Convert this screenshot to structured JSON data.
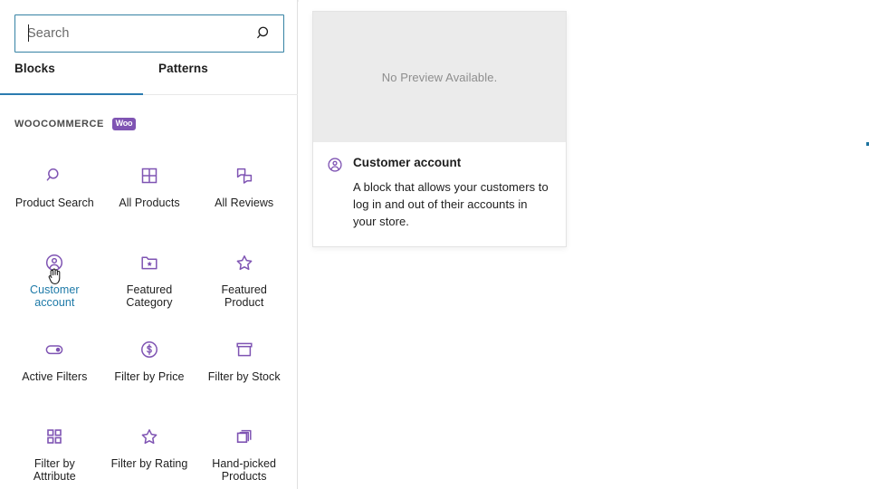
{
  "search": {
    "placeholder": "Search",
    "value": "",
    "icon": "search-icon"
  },
  "tabs": [
    {
      "label": "Blocks",
      "active": true
    },
    {
      "label": "Patterns",
      "active": false
    }
  ],
  "panel": {
    "title": "WOOCOMMERCE",
    "badge": "Woo",
    "badge_color": "#7f54b3"
  },
  "blocks": [
    {
      "label": "Product Search",
      "icon": "search-icon",
      "selected": false
    },
    {
      "label": "All Products",
      "icon": "grid-icon",
      "selected": false
    },
    {
      "label": "All Reviews",
      "icon": "comments-icon",
      "selected": false
    },
    {
      "label": "Customer account",
      "icon": "account-avatar-icon",
      "selected": true
    },
    {
      "label": "Featured Category",
      "icon": "folder-star-icon",
      "selected": false
    },
    {
      "label": "Featured Product",
      "icon": "star-icon",
      "selected": false
    },
    {
      "label": "Active Filters",
      "icon": "toggle-icon",
      "selected": false
    },
    {
      "label": "Filter by Price",
      "icon": "dollar-coin-icon",
      "selected": false
    },
    {
      "label": "Filter by Stock",
      "icon": "archive-box-icon",
      "selected": false
    },
    {
      "label": "Filter by Attribute",
      "icon": "four-squares-icon",
      "selected": false
    },
    {
      "label": "Filter by Rating",
      "icon": "star-icon",
      "selected": false
    },
    {
      "label": "Hand-picked Products",
      "icon": "stacked-squares-icon",
      "selected": false
    }
  ],
  "preview": {
    "media_text": "No Preview Available.",
    "title": "Customer account",
    "icon": "account-avatar-icon",
    "description": "A block that allows your customers to log in and out of their accounts in your store."
  },
  "canvas": {
    "insertion_line_color": "#1e74a0"
  },
  "colors": {
    "icon_purple": "#7f54b3",
    "accent_blue": "#1e7aa8",
    "tab_underline": "#2b7bb0"
  }
}
